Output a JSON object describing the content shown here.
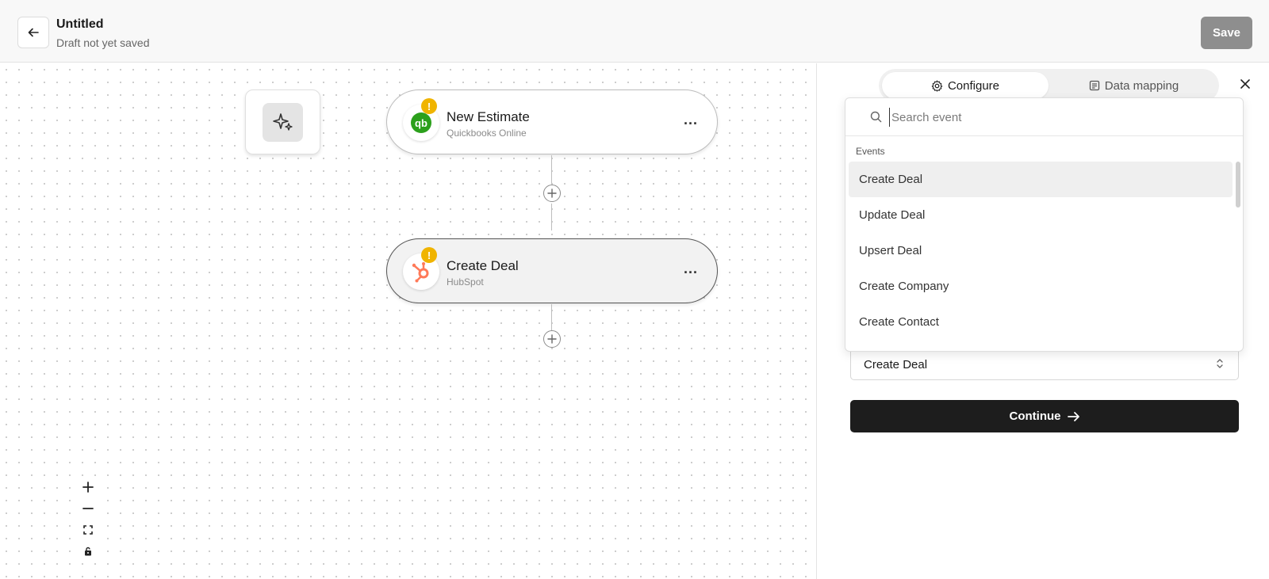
{
  "header": {
    "title": "Untitled",
    "subtitle": "Draft not yet saved",
    "save_label": "Save"
  },
  "canvas": {
    "nodes": [
      {
        "title": "New Estimate",
        "app": "Quickbooks Online",
        "icon": "quickbooks-icon",
        "warning": "!",
        "more": "..."
      },
      {
        "title": "Create Deal",
        "app": "HubSpot",
        "icon": "hubspot-icon",
        "warning": "!",
        "more": "...",
        "selected": true
      }
    ],
    "zoom_controls": [
      "zoom-in-icon",
      "zoom-out-icon",
      "fit-view-icon",
      "lock-icon"
    ]
  },
  "panel": {
    "tabs": [
      {
        "label": "Configure",
        "icon": "gear-icon",
        "active": true
      },
      {
        "label": "Data mapping",
        "icon": "document-icon",
        "active": false
      }
    ],
    "search": {
      "placeholder": "Search event",
      "value": ""
    },
    "group_label": "Events",
    "events": [
      "Create Deal",
      "Update Deal",
      "Upsert Deal",
      "Create Company",
      "Create Contact"
    ],
    "selected_event": "Create Deal",
    "continue_label": "Continue"
  },
  "colors": {
    "save_disabled": "#8e8e8e",
    "warning": "#f0b400",
    "quickbooks": "#2ca01c",
    "hubspot": "#ff7a59",
    "primary_button": "#1d1d1d"
  }
}
